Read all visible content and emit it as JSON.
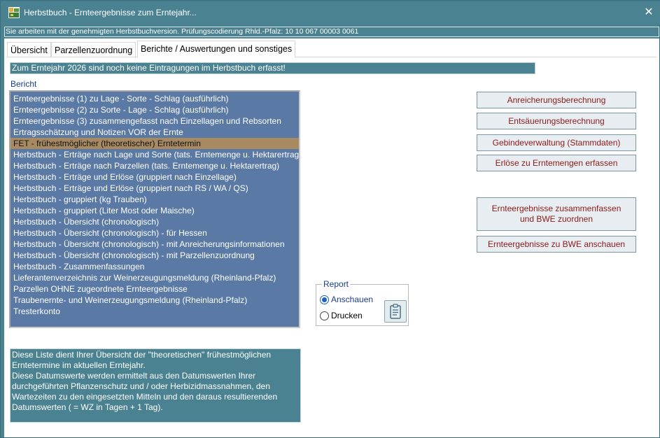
{
  "window": {
    "title": "Herbstbuch - Ernteergebnisse zum Erntejahr...",
    "close_glyph": "✕"
  },
  "status_strip": "Sie arbeiten mit der genehmigten Herbstbuchversion. Prüfungscodierung Rhld.-Pfalz: 10 10 067 00003 0061",
  "tabs": [
    {
      "label": "Übersicht",
      "active": false
    },
    {
      "label": "Parzellenzuordnung",
      "active": false
    },
    {
      "label": "Berichte / Auswertungen und sonstiges",
      "active": true
    }
  ],
  "info_banner": "Zum Erntejahr 2026 sind noch keine Eintragungen im Herbstbuch erfasst!",
  "bericht_label": "Bericht",
  "report_list": {
    "selected_index": 4,
    "items": [
      "Ernteergebnisse (1) zu Lage - Sorte - Schlag (ausführlich)",
      "Ernteergebnisse (2) zu Sorte - Lage - Schlag (ausführlich)",
      "Ernteergebnisse (3) zusammengefasst nach Einzellagen und Rebsorten",
      "Ertragsschätzung und Notizen VOR der Ernte",
      "FET - frühestmöglicher (theoretischer) Erntetermin",
      "Herbstbuch - Erträge nach Lage und Sorte (tats. Erntemenge u. Hektarertrag)",
      "Herbstbuch - Erträge nach Parzellen (tats. Erntemenge u. Hektarertrag)",
      "Herbstbuch - Erträge und Erlöse (gruppiert nach Einzellage)",
      "Herbstbuch - Erträge und Erlöse (gruppiert nach RS / WA / QS)",
      "Herbstbuch - gruppiert (kg Trauben)",
      "Herbstbuch - gruppiert (Liter Most oder Maische)",
      "Herbstbuch - Übersicht (chronologisch)",
      "Herbstbuch - Übersicht (chronologisch) - für Hessen",
      "Herbstbuch - Übersicht (chronologisch) - mit Anreicherungsinformationen",
      "Herbstbuch - Übersicht (chronologisch) - mit Parzellenzuordnung",
      "Herbstbuch - Zusammenfassungen",
      "Lieferantenverzeichnis zur Weinerzeugungsmeldung (Rheinland-Pfalz)",
      "Parzellen OHNE zugeordnete Ernteergebnisse",
      "Traubenernte- und Weinerzeugungsmeldung (Rheinland-Pfalz)",
      "Tresterkonto"
    ]
  },
  "description": [
    "Diese Liste dient Ihrer Übersicht der \"theoretischen\" frühestmöglichen",
    "Erntetermine im aktuellen Erntejahr.",
    "Diese Datumswerte werden ermittelt aus den Datumswerten Ihrer",
    "durchgeführten Pflanzenschutz und / oder Herbizidmassnahmen, den",
    "Wartezeiten zu den eingesetzten Mitteln und den daraus resultierenden",
    "Datumswerten ( = WZ in Tagen + 1 Tag)."
  ],
  "report_group": {
    "legend": "Report",
    "options": [
      {
        "label": "Anschauen",
        "checked": true
      },
      {
        "label": "Drucken",
        "checked": false
      }
    ],
    "button_icon": "document-report-icon"
  },
  "buttons": {
    "anreicherung": "Anreicherungsberechnung",
    "entsaeuerung": "Entsäuerungsberechnung",
    "gebinde": "Gebindeverwaltung (Stammdaten)",
    "erloese": "Erlöse zu Erntemengen erfassen",
    "zusammenfassen_line1": "Ernteergebnisse zusammenfassen",
    "zusammenfassen_line2": "und BWE zuordnen",
    "bwe_anschauen": "Ernteergebnisse zu BWE anschauen"
  },
  "colors": {
    "window_bg": "#4a8291",
    "list_bg": "#5a7aa5",
    "selected_bg": "#a88a62",
    "button_text": "#8b1a1a",
    "label_blue": "#1a3c8c"
  }
}
